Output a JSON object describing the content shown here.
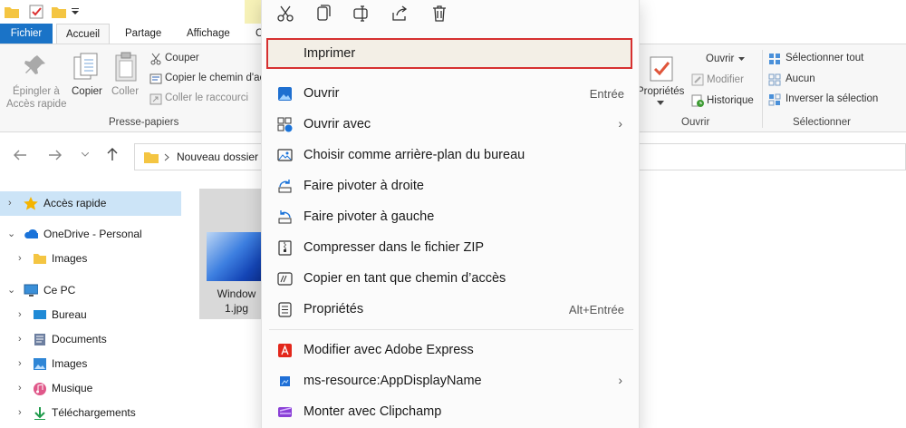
{
  "tabs": {
    "file": "Fichier",
    "home": "Accueil",
    "share": "Partage",
    "view": "Affichage",
    "cut_off": "C"
  },
  "ribbon": {
    "pin_line1": "Épingler à",
    "pin_line2": "Accès rapide",
    "copy": "Copier",
    "paste": "Coller",
    "cut": "Couper",
    "copy_path": "Copier le chemin d'ac",
    "paste_shortcut": "Coller le raccourci",
    "clipboard_group": "Presse-papiers",
    "properties": "Propriétés",
    "open": "Ouvrir",
    "edit": "Modifier",
    "history": "Historique",
    "open_group": "Ouvrir",
    "select_all": "Sélectionner tout",
    "select_none": "Aucun",
    "invert_selection": "Inverser la sélection",
    "select_group": "Sélectionner"
  },
  "address": {
    "crumb": "Nouveau dossier"
  },
  "tree": {
    "quick_access": "Accès rapide",
    "onedrive": "OneDrive - Personal",
    "onedrive_images": "Images",
    "this_pc": "Ce PC",
    "desktop": "Bureau",
    "documents": "Documents",
    "images": "Images",
    "music": "Musique",
    "downloads": "Téléchargements"
  },
  "files": {
    "thumb_line1": "Window",
    "thumb_line2": "1.jpg"
  },
  "menu": {
    "print": "Imprimer",
    "open": "Ouvrir",
    "open_key": "Entrée",
    "open_with": "Ouvrir avec",
    "set_wallpaper": "Choisir comme arrière-plan du bureau",
    "rotate_right": "Faire pivoter à droite",
    "rotate_left": "Faire pivoter à gauche",
    "compress_zip": "Compresser dans le fichier ZIP",
    "copy_path": "Copier en tant que chemin d’accès",
    "properties": "Propriétés",
    "properties_key": "Alt+Entrée",
    "adobe_express": "Modifier avec Adobe Express",
    "ms_resource": "ms-resource:AppDisplayName",
    "clipchamp": "Monter avec Clipchamp"
  },
  "colors": {
    "file_tab": "#1a73c7",
    "highlight_border": "#d63030",
    "selection": "#cce4f7"
  }
}
